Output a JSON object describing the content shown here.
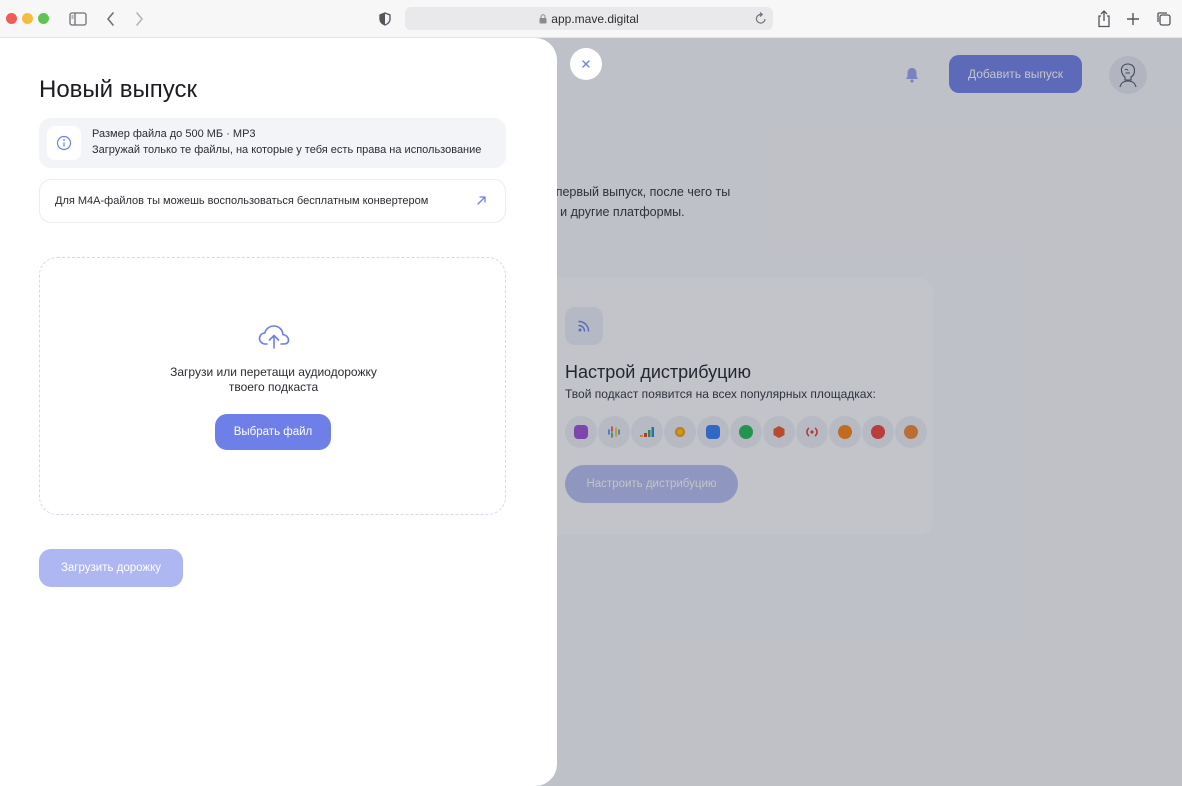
{
  "browser": {
    "url": "app.mave.digital",
    "icons": [
      "sidebar-icon",
      "back-icon",
      "forward-icon",
      "shield-icon",
      "lock-icon",
      "reload-icon",
      "share-icon",
      "new-tab-icon",
      "tabs-icon"
    ]
  },
  "background_app": {
    "add_release_label": "Добавить выпуск",
    "empty_text_line1": "ть первый выпуск, после чего ты",
    "empty_text_line2": "ast и другие платформы.",
    "distribution": {
      "title": "Настрой дистрибуцию",
      "subtitle": "Твой подкаст появится на всех популярных площадках:",
      "button_label": "Настроить дистрибуцию",
      "platform_icons": [
        "apple-podcasts-icon",
        "google-podcasts-icon",
        "deezer-icon",
        "yandex-music-icon",
        "vk-icon",
        "spotify-icon",
        "soundstream-icon",
        "castbox-icon",
        "overcast-icon",
        "pocket-casts-icon",
        "podcast-addict-icon"
      ]
    }
  },
  "modal": {
    "title": "Новый выпуск",
    "info_line1": "Размер файла до 500 МБ · MP3",
    "info_line2": "Загружай только те файлы, на которые у тебя есть права на использование",
    "converter_text": "Для M4A-файлов ты можешь воспользоваться бесплатным конвертером",
    "dropzone_line1": "Загрузи или перетащи аудиодорожку",
    "dropzone_line2": "твоего подкаста",
    "choose_file_label": "Выбрать файл",
    "upload_label": "Загрузить дорожку"
  },
  "colors": {
    "accent": "#6f7fe8",
    "accent_disabled": "#aeb7f1",
    "overlay": "#363a4e"
  }
}
